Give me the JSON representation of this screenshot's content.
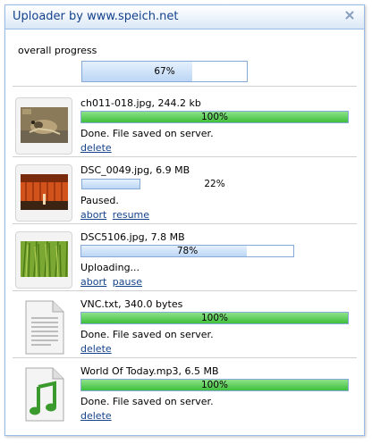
{
  "window": {
    "title": "Uploader by www.speich.net"
  },
  "overall": {
    "label": "overall progress",
    "progress_text": "67%",
    "progress": 0.67
  },
  "files": [
    {
      "name": "ch011-018.jpg, 244.2 kb",
      "progress_text": "100%",
      "progress": 1.0,
      "status": "Done. File saved on server.",
      "actions": [
        "delete"
      ],
      "thumb": "photo-frog"
    },
    {
      "name": "DSC_0049.jpg, 6.9 MB",
      "progress_text": "22%",
      "progress": 0.22,
      "status": "Paused.",
      "actions": [
        "abort",
        "resume"
      ],
      "thumb": "photo-orange"
    },
    {
      "name": "DSC5106.jpg, 7.8 MB",
      "progress_text": "78%",
      "progress": 0.78,
      "status": "Uploading...",
      "actions": [
        "abort",
        "pause"
      ],
      "thumb": "photo-grass"
    },
    {
      "name": "VNC.txt, 340.0 bytes",
      "progress_text": "100%",
      "progress": 1.0,
      "status": "Done. File saved on server.",
      "actions": [
        "delete"
      ],
      "thumb": "text-file-icon"
    },
    {
      "name": "World Of Today.mp3, 6.5 MB",
      "progress_text": "100%",
      "progress": 1.0,
      "status": "Done. File saved on server.",
      "actions": [
        "delete"
      ],
      "thumb": "audio-file-icon"
    }
  ],
  "colors": {
    "title": "#15428b",
    "link": "#15428b",
    "border": "#99bbe8",
    "progress_green": "#3fbf3b",
    "progress_blue": "#bcd6f5"
  }
}
